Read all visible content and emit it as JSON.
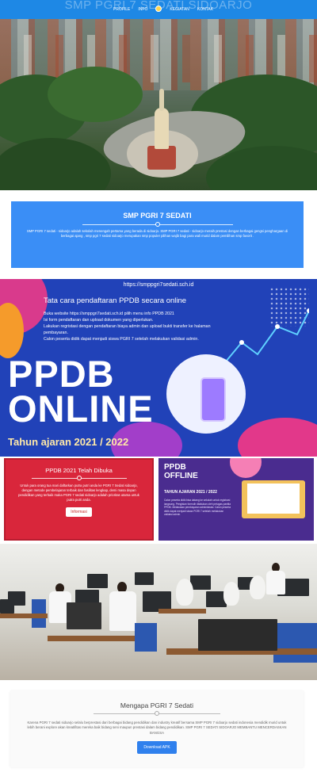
{
  "nav": {
    "site_title": "SMP PGRI 7 SEDATI SIDOARJO",
    "links": [
      "PROFILE",
      "INFO",
      "KEGIATAN",
      "KONTAK"
    ]
  },
  "info": {
    "title": "SMP PGRI 7 SEDATI",
    "text": "SMP PGRI 7 sedati - sidoarjo adalah sekolah menengah pertama yang berada di sidoarjo. SMP PGRI 7 sedati - sidoarjo meraih prestasi dengan berbagai gengsi penghargaan di berbagai ajang , smp pgri 7 sedati sidoarjo merupakan smp populer pilihan wajib bagi para wali murid dalam pemilihan smp favorit ."
  },
  "ppdb": {
    "url": "https://smppgri7sedati.sch.id",
    "heading": "Tata cara pendaftaran PPDB secara online",
    "steps": [
      "Buka website https://smppgri7sedati.sch.id pilih menu info PPDB 2021",
      "Isi form pendaftaran dan upload dokumen yang diperlukan.",
      "Lakukan regristasi dengan pendaftaran biaya admin dan upload bukti transfer ke halaman pembayaran.",
      "Calon peserta didik dapat menjadi siswa PGRI 7 setelah melakukan validasi admin."
    ],
    "big_line1": "PPDB",
    "big_line2": "ONLINE",
    "year": "Tahun ajaran 2021 / 2022"
  },
  "opened_card": {
    "title": "PPDB 2021 Telah Dibuka",
    "text": "Untuk para orang tua mari daftarkan putra putri anda ke PGRI 7 Sedati sidoarjo, dengan metode pembelajaran terbaik dan fasilitas lengkap, demi masa depan pendidikan yang terbaik maka PGRI 7 sedati sidoarjo adalah prioritas utama untuk putra putri anda.",
    "button": "Informasi"
  },
  "offline": {
    "title_line1": "PPDB",
    "title_line2": "OFFLINE",
    "year": "TAHUN AJARAN 2021 / 2022",
    "text": "Calon peserta didik bisa datang ke sekolah untuk registrasi langsung. Pengisian formulir dilakukan oleh petugas panitia PPDB. Melakukan pembayaran administrasi. Calon peserta didik dapat menjadi siswa PGRI 7 setelah melakukan validasi admin."
  },
  "why": {
    "title": "Mengapa PGRI 7 Sedati",
    "text": "Karena PGRI 7 sedati sidoarjo selalu berprestasi dari berbagai bidang pendidikan dan industry kreatif bersama SMP PGRI 7 sidoarjo sedati indonesia mendidik murid untuk lebih berani explore akan kreatifitas mereka baik bidang seni maupun prestasi dalam bidang pendidikan. SMP PGRI 7 SEDATI SIDOARJO MEMBANTU MENCERDASKAN BANGSA",
    "button": "Download APK"
  },
  "colors": {
    "primary": "#1e88e5",
    "card_blue": "#3a8ef6",
    "banner": "#2142b8",
    "red": "#d9263b",
    "offline": "#4a2c8f"
  }
}
